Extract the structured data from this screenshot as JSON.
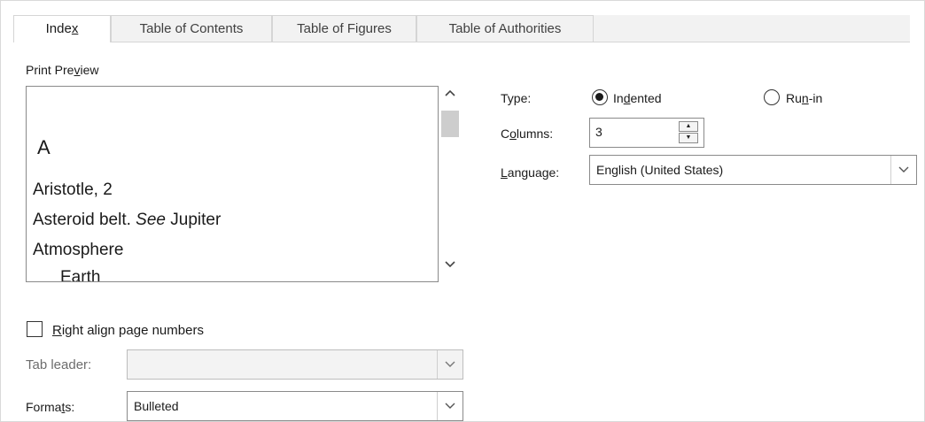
{
  "tabs": [
    {
      "label_pre": "Inde",
      "label_u": "x",
      "label_post": "",
      "active": true
    },
    {
      "label": "Table of Contents",
      "active": false
    },
    {
      "label": "Table of Figures",
      "active": false
    },
    {
      "label": "Table of Authorities",
      "active": false
    }
  ],
  "preview": {
    "label_pre": "Print Pre",
    "label_u": "v",
    "label_post": "iew",
    "letter": "A",
    "lines": [
      {
        "text": "Aristotle, 2"
      },
      {
        "pre": "Asteroid belt. ",
        "italic": "See",
        "post": " Jupiter"
      },
      {
        "text": "Atmosphere"
      },
      {
        "text": "Earth"
      }
    ]
  },
  "type": {
    "label": "Type:",
    "indented_pre": "In",
    "indented_u": "d",
    "indented_post": "ented",
    "runin_pre": "Ru",
    "runin_u": "n",
    "runin_post": "-in",
    "selected": "Indented"
  },
  "columns": {
    "label_pre": "C",
    "label_u": "o",
    "label_post": "lumns:",
    "value": "3"
  },
  "language": {
    "label_pre": "",
    "label_u": "L",
    "label_post": "anguage:",
    "value": "English (United States)"
  },
  "right_align": {
    "label_pre": "",
    "label_u": "R",
    "label_post": "ight align page numbers",
    "checked": false
  },
  "tab_leader": {
    "label": "Tab leader:",
    "value": ""
  },
  "formats": {
    "label_pre": "Forma",
    "label_u": "t",
    "label_post": "s:",
    "value": "Bulleted"
  }
}
